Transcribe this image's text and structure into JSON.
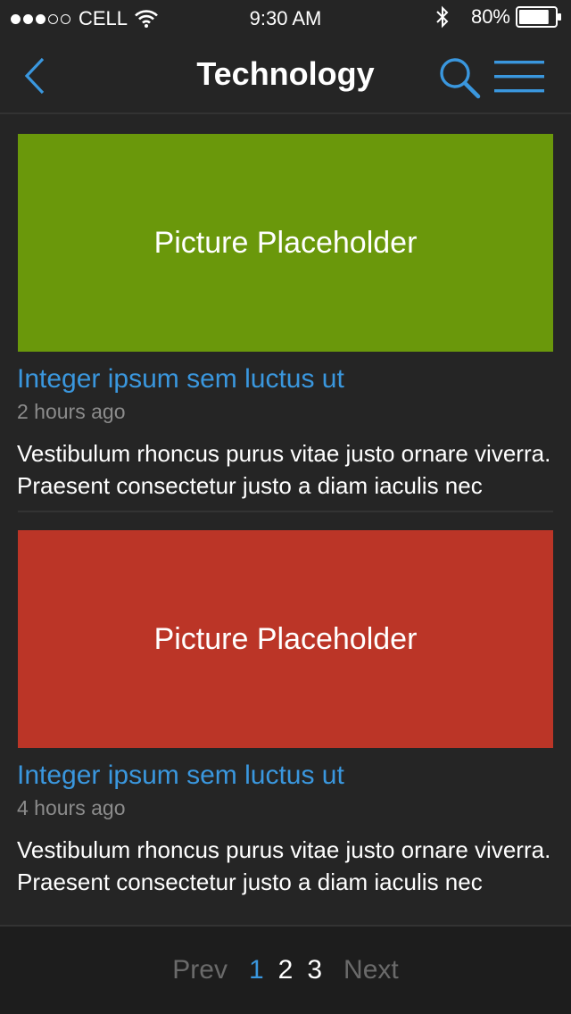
{
  "status_bar": {
    "carrier": "CELL",
    "time": "9:30 AM",
    "battery": "80%",
    "signal_bars_filled": 3,
    "signal_bars_total": 5,
    "battery_level": 0.8
  },
  "nav": {
    "title": "Technology",
    "back_icon": "chevron-left-icon",
    "search_icon": "search-icon",
    "menu_icon": "hamburger-menu-icon",
    "accent_color": "#3a97de"
  },
  "articles": [
    {
      "image_label": "Picture Placeholder",
      "image_color": "#6a980b",
      "headline": "Integer ipsum sem luctus ut",
      "time": "2 hours ago",
      "summary": "Vestibulum rhoncus purus vitae justo ornare viverra. Praesent consectetur justo a diam iaculis nec"
    },
    {
      "image_label": "Picture Placeholder",
      "image_color": "#bb3527",
      "headline": "Integer ipsum sem luctus ut",
      "time": "4 hours ago",
      "summary": "Vestibulum rhoncus purus vitae justo ornare viverra. Praesent consectetur justo a diam iaculis nec"
    }
  ],
  "pagination": {
    "prev_label": "Prev",
    "next_label": "Next",
    "pages": [
      "1",
      "2",
      "3"
    ],
    "current": "1"
  }
}
